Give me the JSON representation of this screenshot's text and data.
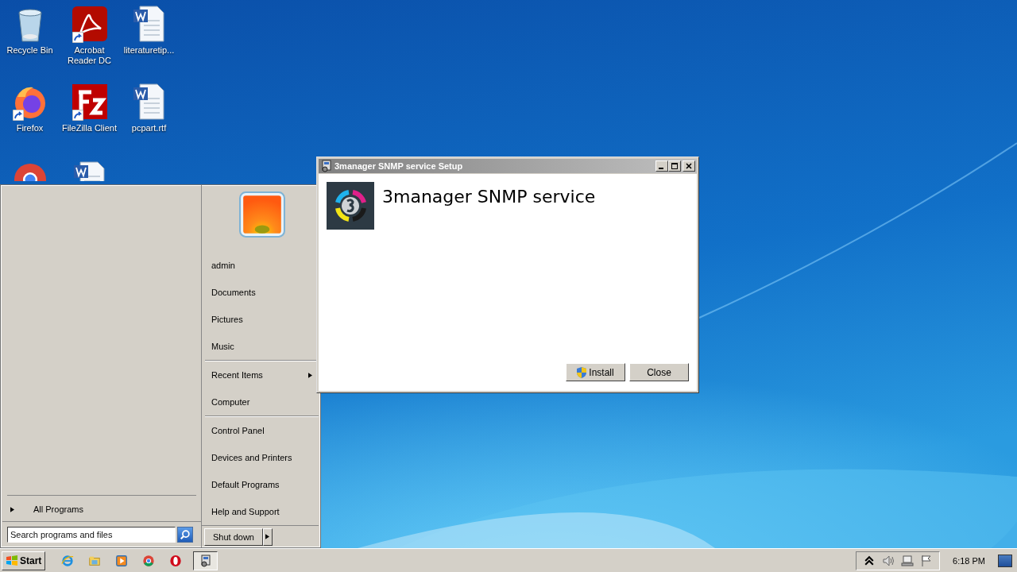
{
  "desktop_icons": [
    {
      "label": "Recycle Bin",
      "kind": "recycle",
      "shortcut": false
    },
    {
      "label": "Acrobat Reader DC",
      "kind": "acrobat",
      "shortcut": true
    },
    {
      "label": "literaturetip...",
      "kind": "word",
      "shortcut": false
    },
    {
      "label": "Firefox",
      "kind": "firefox",
      "shortcut": true
    },
    {
      "label": "FileZilla Client",
      "kind": "filezilla",
      "shortcut": true
    },
    {
      "label": "pcpart.rtf",
      "kind": "word",
      "shortcut": false
    },
    {
      "kind": "chrome",
      "shortcut": false
    },
    {
      "kind": "word",
      "shortcut": false
    }
  ],
  "start_menu": {
    "all_programs": "All Programs",
    "search": {
      "placeholder": "Search programs and files"
    },
    "place_groups": [
      [
        {
          "label": "admin",
          "has_submenu": false
        },
        {
          "label": "Documents",
          "has_submenu": false
        },
        {
          "label": "Pictures",
          "has_submenu": false
        },
        {
          "label": "Music",
          "has_submenu": false
        }
      ],
      [
        {
          "label": "Recent Items",
          "has_submenu": true
        },
        {
          "label": "Computer",
          "has_submenu": false
        }
      ],
      [
        {
          "label": "Control Panel",
          "has_submenu": false
        },
        {
          "label": "Devices and Printers",
          "has_submenu": false
        },
        {
          "label": "Default Programs",
          "has_submenu": false
        },
        {
          "label": "Help and Support",
          "has_submenu": false
        }
      ]
    ],
    "shut_down": "Shut down"
  },
  "dialog": {
    "title": "3manager SNMP service Setup",
    "heading": "3manager SNMP service",
    "buttons": [
      {
        "label": "Install",
        "kind": "shield"
      },
      {
        "label": "Close",
        "kind": "plain"
      }
    ]
  },
  "taskbar": {
    "start": "Start",
    "items": [
      {
        "kind": "ie",
        "selected": false
      },
      {
        "kind": "explorer",
        "selected": false
      },
      {
        "kind": "media",
        "selected": false
      },
      {
        "kind": "chrome",
        "selected": false
      },
      {
        "kind": "opera",
        "selected": false
      },
      {
        "kind": "setup",
        "selected": true
      }
    ],
    "clock": "6:18 PM"
  }
}
